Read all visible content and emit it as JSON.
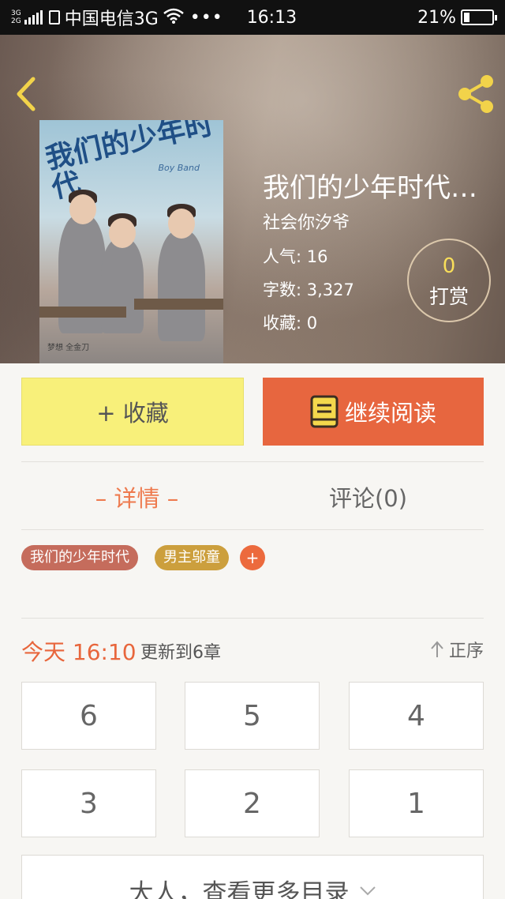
{
  "status_bar": {
    "network_top": "3G",
    "network_bottom": "2G",
    "carrier": "中国电信3G",
    "more": "•••",
    "time": "16:13",
    "battery": "21%",
    "battery_level": 0.21
  },
  "header": {
    "back_icon": "chevron-left-icon",
    "share_icon": "share-icon",
    "accent_color": "#f2d34a"
  },
  "cover": {
    "title": "我们的少年时代",
    "subtitle": "Boy Band",
    "footer": "梦想 全金刀"
  },
  "book": {
    "title": "我们的少年时代…",
    "author": "社会你汐爷",
    "popularity_label": "人气:",
    "popularity": "16",
    "words_label": "字数:",
    "words": "3,327",
    "favorites_label": "收藏:",
    "favorites": "0"
  },
  "reward": {
    "count": "0",
    "label": "打赏"
  },
  "actions": {
    "favorite_label": "+ 收藏",
    "read_label": "继续阅读",
    "favorite_color": "#f8f07a",
    "read_color": "#e7663f"
  },
  "tabs": {
    "detail": "– 详情 –",
    "comments": "评论(0)"
  },
  "tags": {
    "items": [
      "我们的少年时代",
      "男主邬童"
    ],
    "add": "+"
  },
  "update": {
    "time": "今天 16:10",
    "text": "更新到6章",
    "sort_label": "正序"
  },
  "chapters": [
    "6",
    "5",
    "4",
    "3",
    "2",
    "1"
  ],
  "more": {
    "label": "大人，查看更多目录"
  }
}
